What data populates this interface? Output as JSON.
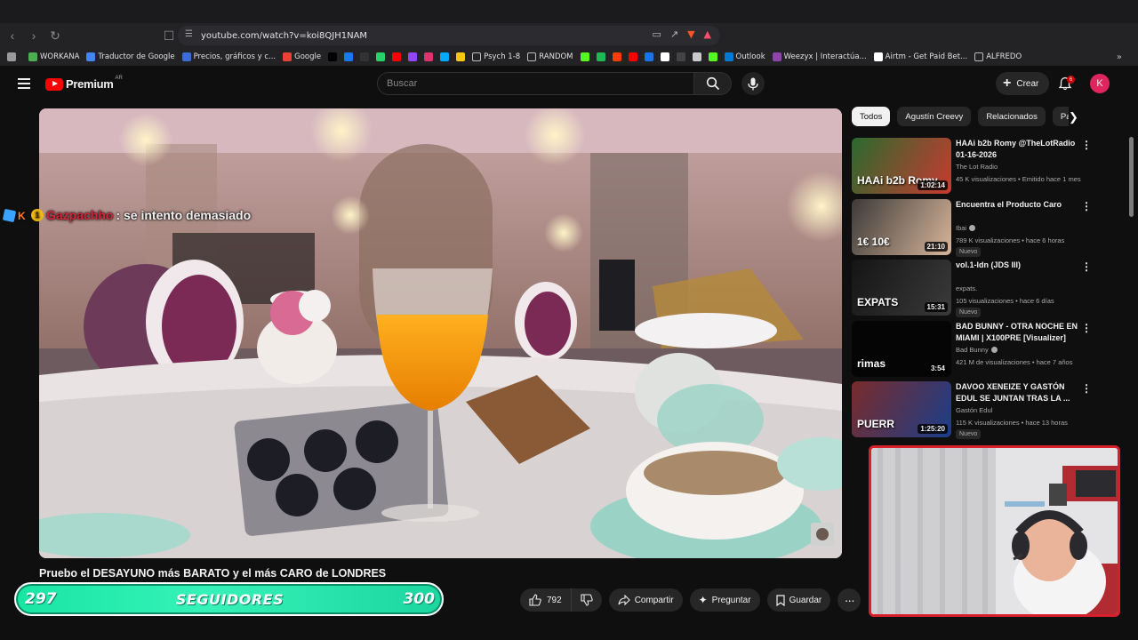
{
  "browser": {
    "url": "youtube.com/watch?v=koi8QJH1NAM",
    "bookmarks": [
      {
        "label": "WORKANA",
        "color": "#4caf50"
      },
      {
        "label": "Traductor de Google",
        "color": "#4285f4"
      },
      {
        "label": "Precios, gráficos y c...",
        "color": "#3b6dd9"
      },
      {
        "label": "Google",
        "color": "#ea4335"
      },
      {
        "label": "",
        "color": "#000000"
      },
      {
        "label": "",
        "color": "#1877f2"
      },
      {
        "label": "",
        "color": "#333333"
      },
      {
        "label": "",
        "color": "#25d366"
      },
      {
        "label": "",
        "color": "#ff0000"
      },
      {
        "label": "",
        "color": "#9146ff"
      },
      {
        "label": "",
        "color": "#e1306c"
      },
      {
        "label": "",
        "color": "#00aaff"
      },
      {
        "label": "",
        "color": "#f5c518"
      },
      {
        "label": "Psych 1-8",
        "color": "#888888",
        "folder": true
      },
      {
        "label": "RANDOM",
        "color": "#888888",
        "folder": true
      },
      {
        "label": "",
        "color": "#53fc18"
      },
      {
        "label": "",
        "color": "#1db954"
      },
      {
        "label": "",
        "color": "#ff3d00"
      },
      {
        "label": "",
        "color": "#ff0000"
      },
      {
        "label": "",
        "color": "#1a73e8"
      },
      {
        "label": "",
        "color": "#ffffff"
      },
      {
        "label": "",
        "color": "#444444"
      },
      {
        "label": "",
        "color": "#cccccc"
      },
      {
        "label": "",
        "color": "#53fc18"
      },
      {
        "label": "Outlook",
        "color": "#0078d4"
      },
      {
        "label": "Weezyx | Interactúa...",
        "color": "#8e44ad"
      },
      {
        "label": "Airtm - Get Paid Bet...",
        "color": "#ffffff"
      },
      {
        "label": "ALFREDO",
        "color": "#888888",
        "folder": true
      }
    ]
  },
  "masthead": {
    "logo_text": "Premium",
    "country": "AR",
    "search_placeholder": "Buscar",
    "create_label": "Crear",
    "notif_count": "6",
    "avatar_letter": "K"
  },
  "video": {
    "title": "Pruebo el DESAYUNO más BARATO y el más CARO de LONDRES",
    "likes": "792",
    "share_label": "Compartir",
    "ask_label": "Preguntar",
    "save_label": "Guardar"
  },
  "chat_overlay": {
    "user": "Gazpachho",
    "message": ": se intento demasiado"
  },
  "followers_goal": {
    "current": "297",
    "label": "SEGUIDORES",
    "target": "300",
    "progress": 0.99
  },
  "chips": [
    "Todos",
    "Agustín Creevy",
    "Relacionados",
    "Par"
  ],
  "related": [
    {
      "title": "HAAi b2b Romy @TheLotRadio 01-16-2026",
      "channel": "The Lot Radio",
      "verified": false,
      "meta": "45 K visualizaciones • Emitido hace 1 mes",
      "duration": "1:02:14",
      "badge": "",
      "thumb_text": "HAAi b2b Romy",
      "colors": [
        "#2a6a2e",
        "#c83a30"
      ]
    },
    {
      "title": "Encuentra el Producto Caro",
      "channel": "Ibai",
      "verified": true,
      "meta": "789 K visualizaciones • hace 6 horas",
      "duration": "21:10",
      "badge": "Nuevo",
      "thumb_text": "1€   10€",
      "colors": [
        "#3d3a38",
        "#d7b59a"
      ]
    },
    {
      "title": "vol.1-ldn (JDS III)",
      "channel": "expats.",
      "verified": false,
      "meta": "105 visualizaciones • hace 6 días",
      "duration": "15:31",
      "badge": "Nuevo",
      "thumb_text": "EXPATS",
      "colors": [
        "#151515",
        "#3a3a3a"
      ]
    },
    {
      "title": "BAD BUNNY - OTRA NOCHE EN MIAMI | X100PRE [Visualizer]",
      "channel": "Bad Bunny",
      "verified": true,
      "meta": "421 M de visualizaciones • hace 7 años",
      "duration": "3:54",
      "badge": "",
      "thumb_text": "rimas",
      "colors": [
        "#050505",
        "#050505"
      ]
    },
    {
      "title": "DAVOO XENEIZE Y GASTÓN EDUL SE JUNTAN TRAS LA ...",
      "channel": "Gastón Edul",
      "verified": false,
      "meta": "115 K visualizaciones • hace 13 horas",
      "duration": "1:25:20",
      "badge": "Nuevo",
      "thumb_text": "PUERR",
      "colors": [
        "#7a2b2b",
        "#1b3e8a"
      ]
    }
  ]
}
